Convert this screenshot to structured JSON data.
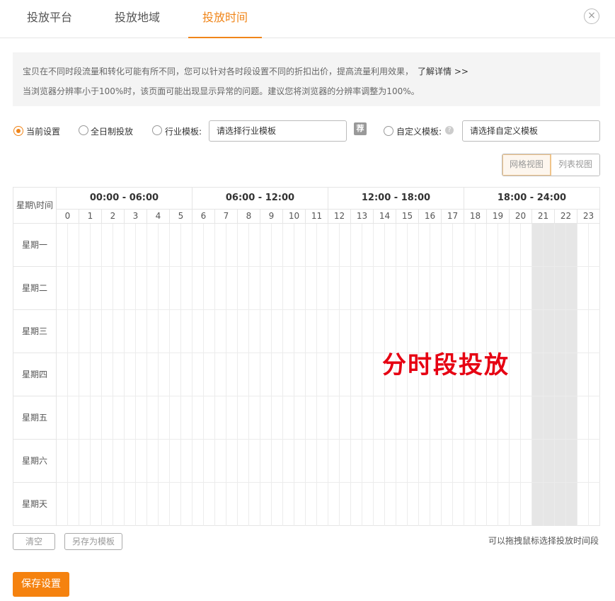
{
  "tabs": [
    {
      "label": "投放平台"
    },
    {
      "label": "投放地域"
    },
    {
      "label": "投放时间"
    }
  ],
  "close_symbol": "×",
  "notice": {
    "line1": "宝贝在不同时段流量和转化可能有所不同，您可以针对各时段设置不同的折扣出价，提高流量利用效果，",
    "more_link": "了解详情 >>",
    "line2": "当浏览器分辨率小于100%时，该页面可能出现显示异常的问题。建议您将浏览器的分辨率调整为100%。"
  },
  "options": {
    "current": "当前设置",
    "fullday": "全日制投放",
    "industry": "行业模板:",
    "industry_placeholder": "请选择行业模板",
    "rec_badge": "荐",
    "help_glyph": "?",
    "custom": "自定义模板:",
    "custom_placeholder": "请选择自定义模板"
  },
  "view": {
    "grid": "网格视图",
    "list": "列表视图"
  },
  "grid": {
    "corner": "星期\\时间",
    "blocks": [
      "00:00 - 06:00",
      "06:00 - 12:00",
      "12:00 - 18:00",
      "18:00 - 24:00"
    ],
    "hours": [
      "0",
      "1",
      "2",
      "3",
      "4",
      "5",
      "6",
      "7",
      "8",
      "9",
      "10",
      "11",
      "12",
      "13",
      "14",
      "15",
      "16",
      "17",
      "18",
      "19",
      "20",
      "21",
      "22",
      "23"
    ],
    "days": [
      "星期一",
      "星期二",
      "星期三",
      "星期四",
      "星期五",
      "星期六",
      "星期天"
    ],
    "selected_hours": [
      21,
      22
    ]
  },
  "overlay_text": "分时段投放",
  "bottom": {
    "clear": "清空",
    "save_template": "另存为模板",
    "hint": "可以拖拽鼠标选择投放时间段",
    "save": "保存设置"
  },
  "colors": {
    "accent": "#f08519",
    "overlay": "#e60012",
    "save_button": "#f5820f"
  }
}
